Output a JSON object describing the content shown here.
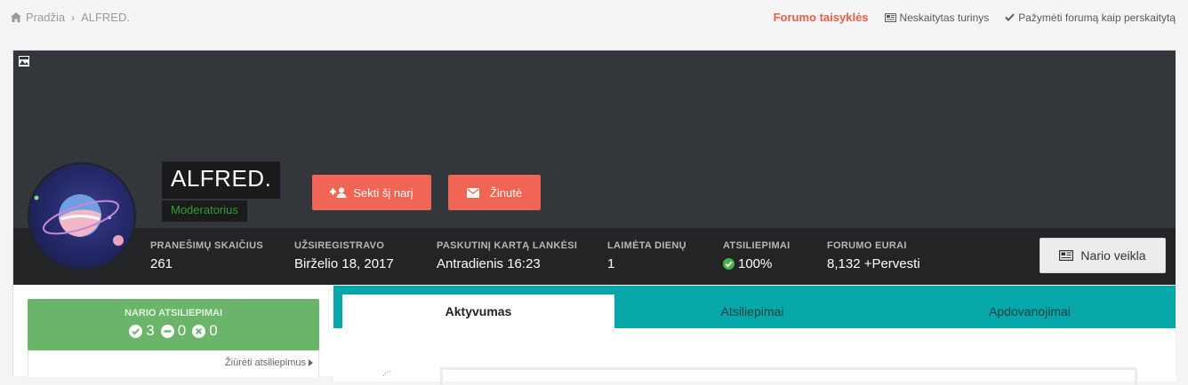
{
  "breadcrumb": {
    "home": "Pradžia",
    "current": "ALFRED."
  },
  "top_links": {
    "rules": "Forumo taisyklės",
    "unread": "Neskaitytas turinys",
    "mark_read": "Pažymėti forumą kaip perskaitytą"
  },
  "profile": {
    "name": "ALFRED.",
    "role": "Moderatorius",
    "follow_button": "Sekti šį narį",
    "message_button": "Žinutė",
    "activity_button": "Nario veikla"
  },
  "stats": [
    {
      "label": "PRANEŠIMŲ SKAIČIUS",
      "value": "261"
    },
    {
      "label": "UŽSIREGISTRAVO",
      "value": "Birželio 18, 2017"
    },
    {
      "label": "PASKUTINĮ KARTĄ LANKĖSI",
      "value": "Antradienis 16:23"
    },
    {
      "label": "LAIMĖTA DIENŲ",
      "value": "1"
    },
    {
      "label": "ATSILIEPIMAI",
      "value": "100%"
    },
    {
      "label": "FORUMO EURAI",
      "value": "8,132 +Pervesti"
    }
  ],
  "feedback": {
    "label": "NARIO ATSILIEPIMAI",
    "positive": "3",
    "neutral": "0",
    "negative": "0",
    "link": "Žiūrėti atsiliepimus"
  },
  "tabs": [
    {
      "label": "Aktyvumas",
      "active": true
    },
    {
      "label": "Atsiliepimai",
      "active": false
    },
    {
      "label": "Apdovanojimai",
      "active": false
    }
  ],
  "colors": {
    "accent_red": "#f06553",
    "teal": "#05a7a8",
    "feedback_green": "#6bb56a",
    "cover": "#33373b",
    "statsbar": "#222426"
  }
}
